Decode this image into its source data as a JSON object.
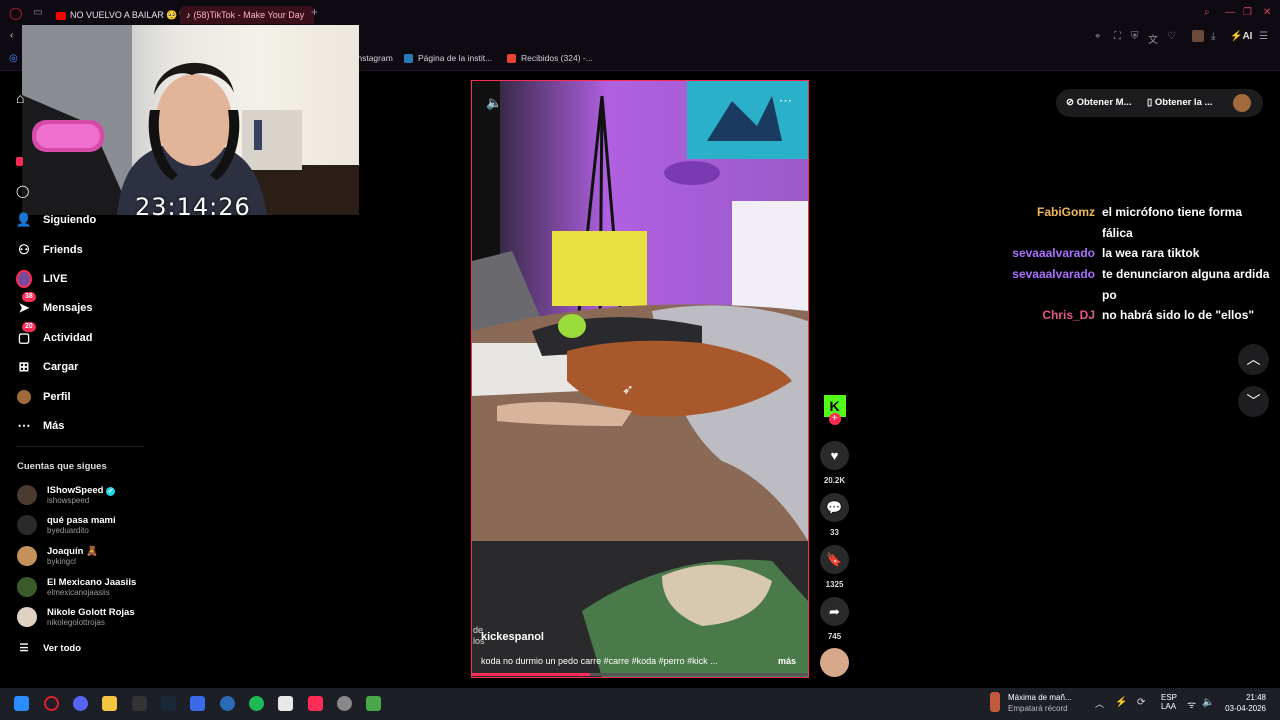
{
  "browser": {
    "tabs": [
      {
        "label": "NO VUELVO A BAILAR 🥺🤘",
        "active": false,
        "icon_color": "#ff0000"
      },
      {
        "label": "(58)TikTok - Make Your Day",
        "active": true,
        "icon_color": "#ffffff"
      }
    ],
    "new_tab": "+",
    "bookmarks": [
      {
        "label": "Instagram",
        "icon_color": "#c13584"
      },
      {
        "label": "Página de la instit...",
        "icon_color": "#2a7ab8"
      },
      {
        "label": "Recibidos (324) -...",
        "icon_color": "#ea4335"
      }
    ],
    "toolbar_ai": "AI"
  },
  "webcam": {
    "clock": "23:14:26"
  },
  "sidebar": {
    "nav": [
      {
        "label": "Siguiendo",
        "icon": "people-icon"
      },
      {
        "label": "Friends",
        "icon": "friends-icon"
      },
      {
        "label": "LIVE",
        "icon": "live-icon"
      },
      {
        "label": "Mensajes",
        "icon": "message-icon",
        "badge": "38"
      },
      {
        "label": "Actividad",
        "icon": "inbox-icon",
        "badge": "20"
      },
      {
        "label": "Cargar",
        "icon": "upload-icon"
      },
      {
        "label": "Perfil",
        "icon": "profile-avatar-icon"
      },
      {
        "label": "Más",
        "icon": "more-dots-icon"
      }
    ],
    "following_title": "Cuentas que sigues",
    "following": [
      {
        "name": "IShowSpeed",
        "handle": "ishowspeed",
        "verified": true,
        "avatar_color": "#4a3a30"
      },
      {
        "name": "qué pasa mami",
        "handle": "byeduardito",
        "verified": false,
        "avatar_color": "#2a2a2a"
      },
      {
        "name": "Joaquín 🧸",
        "handle": "bykingcl",
        "verified": false,
        "avatar_color": "#c4915a"
      },
      {
        "name": "El Mexicano Jaasiis",
        "handle": "elmexicanojaasiis",
        "verified": false,
        "avatar_color": "#3a5a2a"
      },
      {
        "name": "Nikole Golott Rojas",
        "handle": "nikolegolottrojas",
        "verified": false,
        "avatar_color": "#e0d2c2"
      }
    ],
    "see_all": "Ver todo"
  },
  "video": {
    "author": "kickespanol",
    "caption": "koda no durmio un pedo carre #carre #koda #perro #kick ...",
    "more": "más",
    "overlay_text": "de\nlos",
    "progress": 0.35
  },
  "actions": [
    {
      "name": "like",
      "count": "20.2K",
      "icon": "heart-icon"
    },
    {
      "name": "comment",
      "count": "33",
      "icon": "comment-icon"
    },
    {
      "name": "save",
      "count": "1325",
      "icon": "bookmark-icon"
    },
    {
      "name": "share",
      "count": "745",
      "icon": "share-icon"
    }
  ],
  "top_right": {
    "btn1": "Obtener M...",
    "btn2": "Obtener la ..."
  },
  "chat": [
    {
      "user": "FabiGomz",
      "color": "#f0b85a",
      "lines": [
        "el micrófono tiene forma",
        "fálica"
      ]
    },
    {
      "user": "sevaaalvarado",
      "color": "#a970ff",
      "lines": [
        "la wea rara tiktok"
      ]
    },
    {
      "user": "sevaaalvarado",
      "color": "#a970ff",
      "lines": [
        "te denunciaron alguna ardida",
        "po"
      ]
    },
    {
      "user": "Chris_DJ",
      "color": "#e05a8a",
      "lines": [
        "no habrá sido lo de \"ellos\""
      ]
    }
  ],
  "taskbar": {
    "weather_title": "Máxima de mañ...",
    "weather_sub": "Empatará récord",
    "lang": "ESP",
    "lang_sub": "LAA",
    "time": "21:48",
    "date": "03-04-2026"
  }
}
